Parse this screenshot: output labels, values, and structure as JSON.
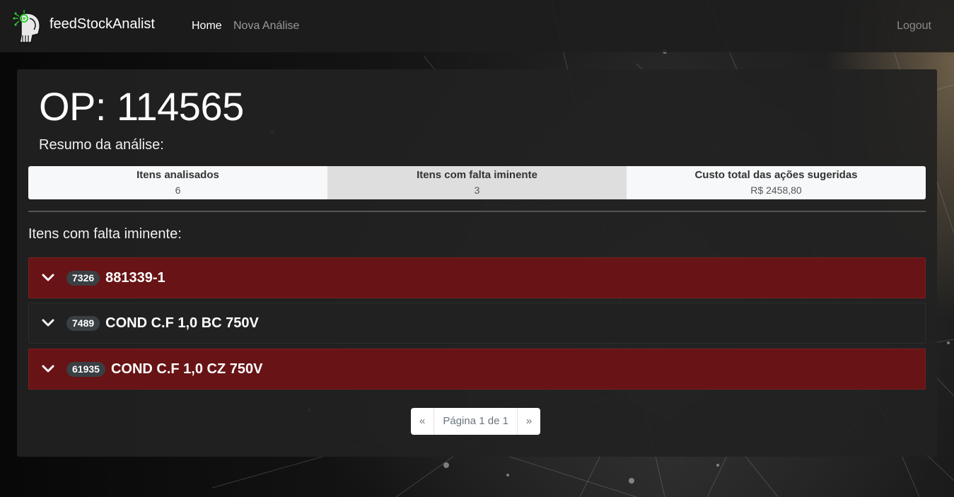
{
  "navbar": {
    "brand": "feedStockAnalist",
    "links": [
      "Home",
      "Nova Análise"
    ],
    "logout": "Logout"
  },
  "page": {
    "title": "OP: 114565",
    "resumo_label": "Resumo da análise:",
    "summary": [
      {
        "label": "Itens analisados",
        "value": "6"
      },
      {
        "label": "Itens com falta iminente",
        "value": "3"
      },
      {
        "label": "Custo total das ações sugeridas",
        "value": "R$ 2458,80"
      }
    ],
    "faltas_label": "Itens com falta iminente:",
    "items": [
      {
        "code": "7326",
        "name": "881339-1",
        "status": "red"
      },
      {
        "code": "7489",
        "name": "COND C.F 1,0 BC 750V",
        "status": "dark"
      },
      {
        "code": "61935",
        "name": "COND C.F 1,0 CZ 750V",
        "status": "red"
      }
    ],
    "pagination": {
      "prev": "«",
      "page": "Página 1 de 1",
      "next": "»"
    }
  },
  "colors": {
    "danger_row": "#6e1214",
    "dark_row": "#222222",
    "badge": "#3a3f44"
  }
}
